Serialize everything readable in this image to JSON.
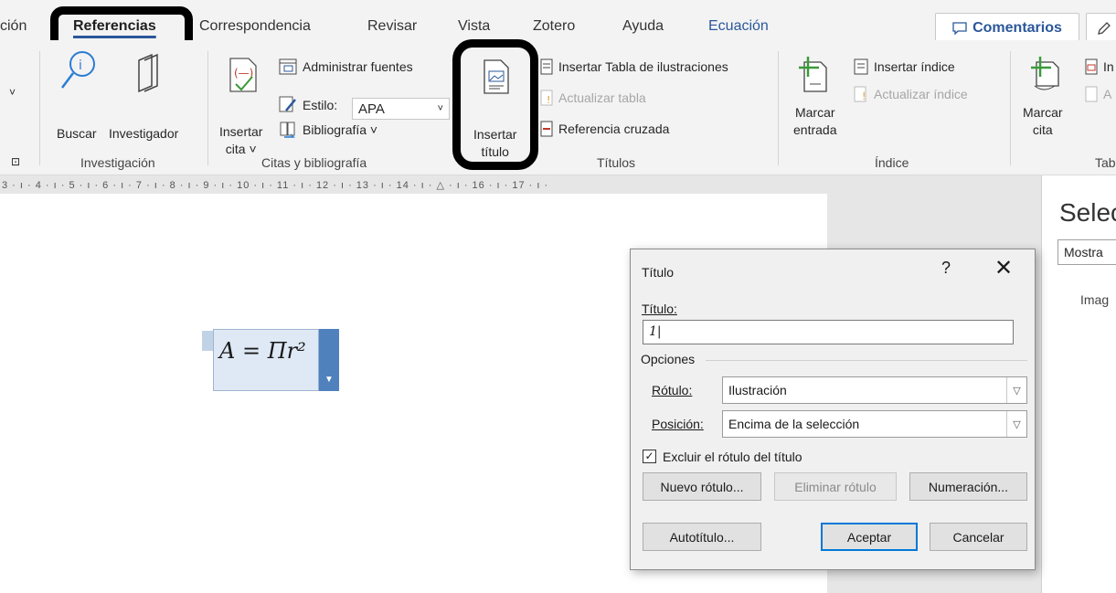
{
  "tabs": {
    "cut_left": "ción",
    "items": [
      "Referencias",
      "Correspondencia",
      "Revisar",
      "Vista",
      "Zotero",
      "Ayuda",
      "Ecuación"
    ],
    "active": "Referencias",
    "comments_label": "Comentarios"
  },
  "ribbon": {
    "investigacion": {
      "buscar": "Buscar",
      "investigador": "Investigador",
      "group_label": "Investigación"
    },
    "citas": {
      "insertar_cita": [
        "Insertar",
        "cita ˅"
      ],
      "administrar_fuentes": "Administrar fuentes",
      "estilo_label": "Estilo:",
      "estilo_value": "APA",
      "bibliografia": "Bibliografía ˅",
      "group_label": "Citas y bibliografía"
    },
    "titulos": {
      "insertar_titulo": [
        "Insertar",
        "título"
      ],
      "insertar_tabla": "Insertar Tabla de ilustraciones",
      "actualizar_tabla": "Actualizar tabla",
      "referencia_cruzada": "Referencia cruzada",
      "group_label": "Títulos"
    },
    "indice": {
      "marcar_entrada": [
        "Marcar",
        "entrada"
      ],
      "insertar_indice": "Insertar índice",
      "actualizar_indice": "Actualizar índice",
      "group_label": "Índice"
    },
    "tabla_autoridades": {
      "marcar_cita": [
        "Marcar",
        "cita"
      ],
      "cut_insertar": "In",
      "cut_actualizar": "A",
      "group_label": "Tab"
    }
  },
  "ruler": {
    "text": "3 · ı · 4 · ı · 5 · ı · 6 · ı · 7 · ı · 8 · ı · 9 · ı · 10 · ı · 11 · ı · 12 · ı · 13 · ı · 14 · ı · △ · ı · 16 · ı · 17 · ı ·"
  },
  "document": {
    "equation": "A = Πr²"
  },
  "side_pane": {
    "title": "Selec",
    "button": "Mostra",
    "text": "Imag"
  },
  "dialog": {
    "title": "Título",
    "help": "?",
    "close": "✕",
    "titulo_label": "Título:",
    "titulo_value": "1",
    "opciones_label": "Opciones",
    "rotulo_label": "Rótulo:",
    "rotulo_value": "Ilustración",
    "posicion_label": "Posición:",
    "posicion_value": "Encima de la selección",
    "excluir_label": "Excluir el rótulo del título",
    "excluir_checked": true,
    "nuevo_rotulo": "Nuevo rótulo...",
    "eliminar_rotulo": "Eliminar rótulo",
    "numeracion": "Numeración...",
    "autotitulo": "Autotítulo...",
    "aceptar": "Aceptar",
    "cancelar": "Cancelar"
  }
}
